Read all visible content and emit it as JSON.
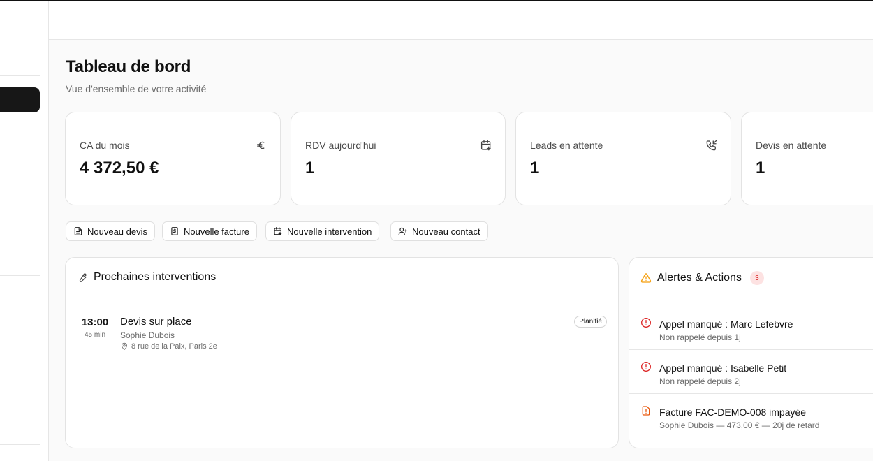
{
  "page": {
    "title": "Tableau de bord",
    "subtitle": "Vue d'ensemble de votre activité"
  },
  "kpis": [
    {
      "label": "CA du mois",
      "value": "4 372,50 €",
      "icon": "euro-icon"
    },
    {
      "label": "RDV aujourd'hui",
      "value": "1",
      "icon": "calendar-plus-icon"
    },
    {
      "label": "Leads en attente",
      "value": "1",
      "icon": "phone-incoming-icon"
    },
    {
      "label": "Devis en attente",
      "value": "1",
      "icon": ""
    }
  ],
  "quick_actions": [
    {
      "label": "Nouveau devis",
      "icon": "document-icon"
    },
    {
      "label": "Nouvelle facture",
      "icon": "invoice-icon"
    },
    {
      "label": "Nouvelle intervention",
      "icon": "calendar-plus-icon"
    },
    {
      "label": "Nouveau contact",
      "icon": "user-plus-icon"
    }
  ],
  "interventions": {
    "title": "Prochaines interventions",
    "icon": "wrench-icon",
    "items": [
      {
        "time": "13:00",
        "duration": "45 min",
        "title": "Devis sur place",
        "client": "Sophie Dubois",
        "address": "8 rue de la Paix, Paris 2e",
        "status": "Planifié"
      }
    ]
  },
  "alerts": {
    "title": "Alertes & Actions",
    "count": "3",
    "icon": "warning-icon",
    "items": [
      {
        "title": "Appel manqué : Marc Lefebvre",
        "subtitle": "Non rappelé depuis 1j",
        "icon": "alert-circle-icon",
        "color": "#dc2626"
      },
      {
        "title": "Appel manqué : Isabelle Petit",
        "subtitle": "Non rappelé depuis 2j",
        "icon": "alert-circle-icon",
        "color": "#dc2626"
      },
      {
        "title": "Facture FAC-DEMO-008 impayée",
        "subtitle": "Sophie Dubois — 473,00 € — 20j de retard",
        "icon": "alert-file-icon",
        "color": "#ea580c"
      }
    ]
  },
  "colors": {
    "accent_dark": "#171717",
    "danger": "#dc2626",
    "warning": "#ea580c",
    "warning_triangle": "#f59e0b"
  }
}
